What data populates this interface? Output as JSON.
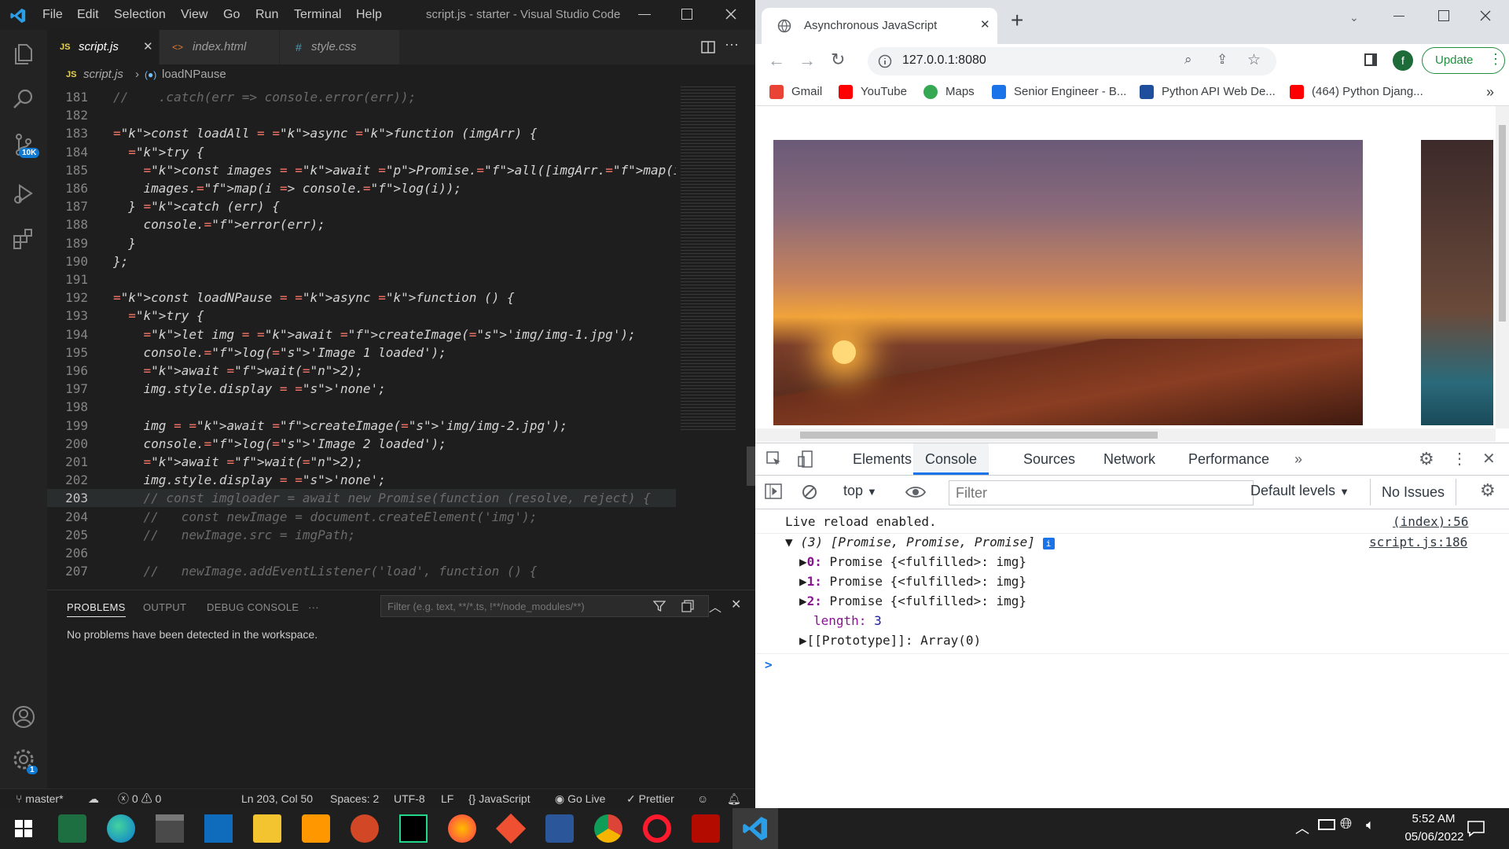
{
  "vscode": {
    "window_title": "script.js - starter - Visual Studio Code",
    "menu": [
      "File",
      "Edit",
      "Selection",
      "View",
      "Go",
      "Run",
      "Terminal",
      "Help"
    ],
    "tabs": [
      {
        "label": "script.js",
        "icon": "JS"
      },
      {
        "label": "index.html",
        "icon": "<>"
      },
      {
        "label": "style.css",
        "icon": "#"
      }
    ],
    "breadcrumb": {
      "file": "script.js",
      "symbol": "loadNPause"
    },
    "source_control_badge": "10K",
    "settings_badge": "1",
    "code_lines": [
      {
        "n": "181",
        "text": "//    .catch(err => console.error(err));"
      },
      {
        "n": "182",
        "text": ""
      },
      {
        "n": "183",
        "text": "const loadAll = async function (imgArr) {"
      },
      {
        "n": "184",
        "text": "  try {"
      },
      {
        "n": "185",
        "text": "    const images = await Promise.all([imgArr.map(img => createImage(img))])"
      },
      {
        "n": "186",
        "text": "    images.map(i => console.log(i));"
      },
      {
        "n": "187",
        "text": "  } catch (err) {"
      },
      {
        "n": "188",
        "text": "    console.error(err);"
      },
      {
        "n": "189",
        "text": "  }"
      },
      {
        "n": "190",
        "text": "};"
      },
      {
        "n": "191",
        "text": ""
      },
      {
        "n": "192",
        "text": "const loadNPause = async function () {"
      },
      {
        "n": "193",
        "text": "  try {"
      },
      {
        "n": "194",
        "text": "    let img = await createImage('img/img-1.jpg');"
      },
      {
        "n": "195",
        "text": "    console.log('Image 1 loaded');"
      },
      {
        "n": "196",
        "text": "    await wait(2);"
      },
      {
        "n": "197",
        "text": "    img.style.display = 'none';"
      },
      {
        "n": "198",
        "text": ""
      },
      {
        "n": "199",
        "text": "    img = await createImage('img/img-2.jpg');"
      },
      {
        "n": "200",
        "text": "    console.log('Image 2 loaded');"
      },
      {
        "n": "201",
        "text": "    await wait(2);"
      },
      {
        "n": "202",
        "text": "    img.style.display = 'none';"
      },
      {
        "n": "203",
        "text": "    // const imgloader = await new Promise(function (resolve, reject) {"
      },
      {
        "n": "204",
        "text": "    //   const newImage = document.createElement('img');"
      },
      {
        "n": "205",
        "text": "    //   newImage.src = imgPath;"
      },
      {
        "n": "206",
        "text": ""
      },
      {
        "n": "207",
        "text": "    //   newImage.addEventListener('load', function () {"
      }
    ],
    "panel": {
      "tabs": [
        "PROBLEMS",
        "OUTPUT",
        "DEBUG CONSOLE",
        "···"
      ],
      "filter_placeholder": "Filter (e.g. text, **/*.ts, !**/node_modules/**)",
      "message": "No problems have been detected in the workspace."
    },
    "status": {
      "branch": "master*",
      "errors": "0",
      "warnings": "0",
      "position": "Ln 203, Col 50",
      "spaces": "Spaces: 2",
      "encoding": "UTF-8",
      "eol": "LF",
      "language": "JavaScript",
      "golive": "Go Live",
      "prettier": "Prettier"
    }
  },
  "chrome": {
    "tab_title": "Asynchronous JavaScript",
    "url": "127.0.0.1:8080",
    "profile_initial": "f",
    "update_label": "Update",
    "bookmarks": [
      {
        "label": "Gmail",
        "color": "#ea4335"
      },
      {
        "label": "YouTube",
        "color": "#ff0000"
      },
      {
        "label": "Maps",
        "color": "#34a853"
      },
      {
        "label": "Senior Engineer - B...",
        "color": "#1a73e8"
      },
      {
        "label": "Python API Web De...",
        "color": "#1f4e9c"
      },
      {
        "label": "(464) Python Djang...",
        "color": "#ff0000"
      }
    ],
    "devtools": {
      "tabs": [
        "Elements",
        "Console",
        "Sources",
        "Network",
        "Performance"
      ],
      "context": "top",
      "filter_placeholder": "Filter",
      "levels": "Default levels",
      "issues": "No Issues",
      "console": {
        "live_reload": "Live reload enabled.",
        "live_reload_src": "(index):56",
        "array_summary": "(3) [Promise, Promise, Promise]",
        "array_src": "script.js:186",
        "items": [
          {
            "idx": "0:",
            "text": "Promise {<fulfilled>: img}"
          },
          {
            "idx": "1:",
            "text": "Promise {<fulfilled>: img}"
          },
          {
            "idx": "2:",
            "text": "Promise {<fulfilled>: img}"
          }
        ],
        "length_key": "length:",
        "length_val": "3",
        "prototype": "[[Prototype]]: Array(0)",
        "prompt": ">"
      }
    }
  },
  "taskbar": {
    "time": "5:52 AM",
    "date": "05/06/2022",
    "apps": [
      "excel",
      "edge",
      "store",
      "mail",
      "explorer",
      "sublime",
      "powerpoint",
      "pycharm",
      "firefox",
      "git",
      "word",
      "chrome",
      "opera",
      "acrobat",
      "vscode"
    ]
  }
}
